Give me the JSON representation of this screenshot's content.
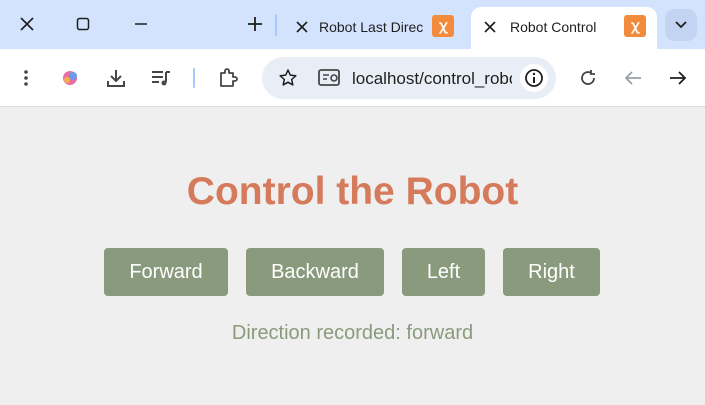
{
  "browser": {
    "tabs": [
      {
        "title": "Robot Last Direction",
        "active": false,
        "favicon": "xampp-icon"
      },
      {
        "title": "Robot Control",
        "active": true,
        "favicon": "xampp-icon"
      }
    ],
    "favicon_glyph": "ꭓ",
    "address_bar": {
      "url": "localhost/control_robot.php"
    }
  },
  "page": {
    "title": "Control the Robot",
    "buttons": {
      "forward": "Forward",
      "backward": "Backward",
      "left": "Left",
      "right": "Right"
    },
    "status": "Direction recorded: forward"
  },
  "colors": {
    "title": "#d57a5b",
    "button_bg": "#8a9a7c",
    "status_text": "#8a9a7c",
    "background": "#efefef",
    "favicon": "#f38b3c"
  }
}
